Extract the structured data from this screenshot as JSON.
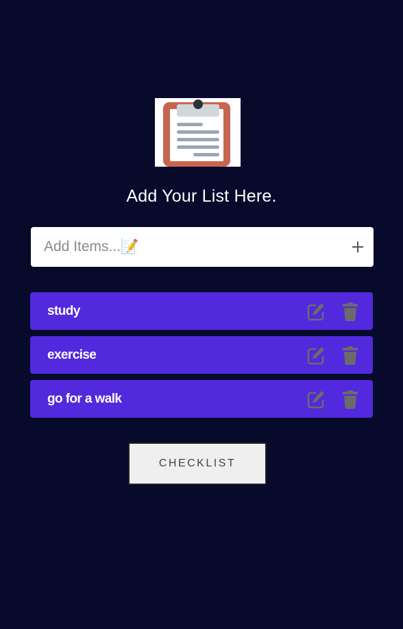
{
  "logo": {
    "icon": "clipboard-icon"
  },
  "heading": "Add Your List Here.",
  "input": {
    "placeholder": "Add Items...📝",
    "value": "",
    "add_icon": "plus-icon"
  },
  "items": [
    {
      "label": "study"
    },
    {
      "label": "exercise"
    },
    {
      "label": "go for a walk"
    }
  ],
  "item_icons": {
    "edit": "edit-icon",
    "delete": "trash-icon"
  },
  "checklist_button": {
    "label": "CHECKLIST"
  },
  "colors": {
    "background": "#080a2b",
    "item_background": "#5229dc",
    "icon_gray": "#6b6b6b"
  }
}
